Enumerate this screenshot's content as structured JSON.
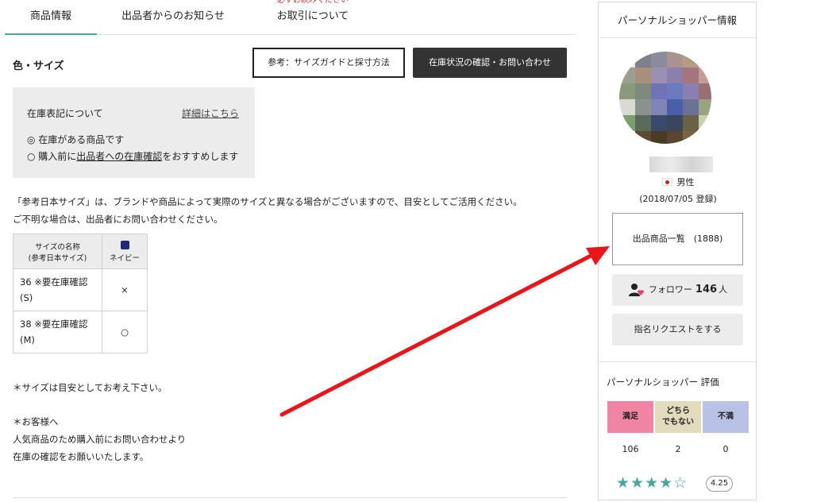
{
  "tabs": [
    {
      "label": "商品情報"
    },
    {
      "label": "出品者からのお知らせ"
    },
    {
      "label": "お取引について",
      "note": "必ずお読みください"
    }
  ],
  "section": {
    "title": "色・サイズ"
  },
  "buttons": {
    "size_guide": "参考：サイズガイドと採寸方法",
    "stock_inquiry": "在庫状況の確認・お問い合わせ"
  },
  "stock_box": {
    "title": "在庫表記について",
    "detail_link": "詳細はこちら",
    "line1": "◎ 在庫がある商品です",
    "line2_prefix": "○ 購入前に",
    "line2_link": "出品者への在庫確認",
    "line2_suffix": "をおすすめします"
  },
  "notice": {
    "line1": "「参考日本サイズ」は、ブランドや商品によって実際のサイズと異なる場合がございますので、目安としてご活用ください。",
    "line2": "ご不明な場合は、出品者にお問い合わせください。"
  },
  "size_table": {
    "header_name_1": "サイズの名称",
    "header_name_2": "(参考日本サイズ)",
    "color_name": "ネイビー",
    "color_hex": "#1f2b7a",
    "rows": [
      {
        "name_1": "36 ※要在庫確認",
        "name_2": "(S)",
        "mark": "×"
      },
      {
        "name_1": "38 ※要在庫確認",
        "name_2": "(M)",
        "mark": "○"
      }
    ]
  },
  "notes": {
    "size_note": "＊サイズは目安としてお考え下さい。",
    "customer_1": "＊お客様へ",
    "customer_2": "人気商品のため購入前にお問い合わせより",
    "customer_3": "在庫の確認をお願いいたします。"
  },
  "shopper": {
    "panel_title": "パーソナルショッパー情報",
    "gender": "男性",
    "registered": "(2018/07/05 登録)",
    "listing_button": "出品商品一覧　(1888)",
    "follower_label": "フォロワー",
    "follower_count": "146",
    "follower_unit": "人",
    "request_button": "指名リクエストをする"
  },
  "evaluation": {
    "title": "パーソナルショッパー 評価",
    "good_label": "満足",
    "neutral_label_1": "どちら",
    "neutral_label_2": "でもない",
    "bad_label": "不満",
    "good": "106",
    "neutral": "2",
    "bad": "0",
    "rating": "4.25",
    "stars_filled": "★★★★",
    "stars_empty": "☆"
  },
  "colors": {
    "accent": "#4aa59b",
    "arrow": "#e8151b",
    "good": "#ef84a4",
    "neutral": "#e2dcbc",
    "bad": "#b7c2e6"
  }
}
